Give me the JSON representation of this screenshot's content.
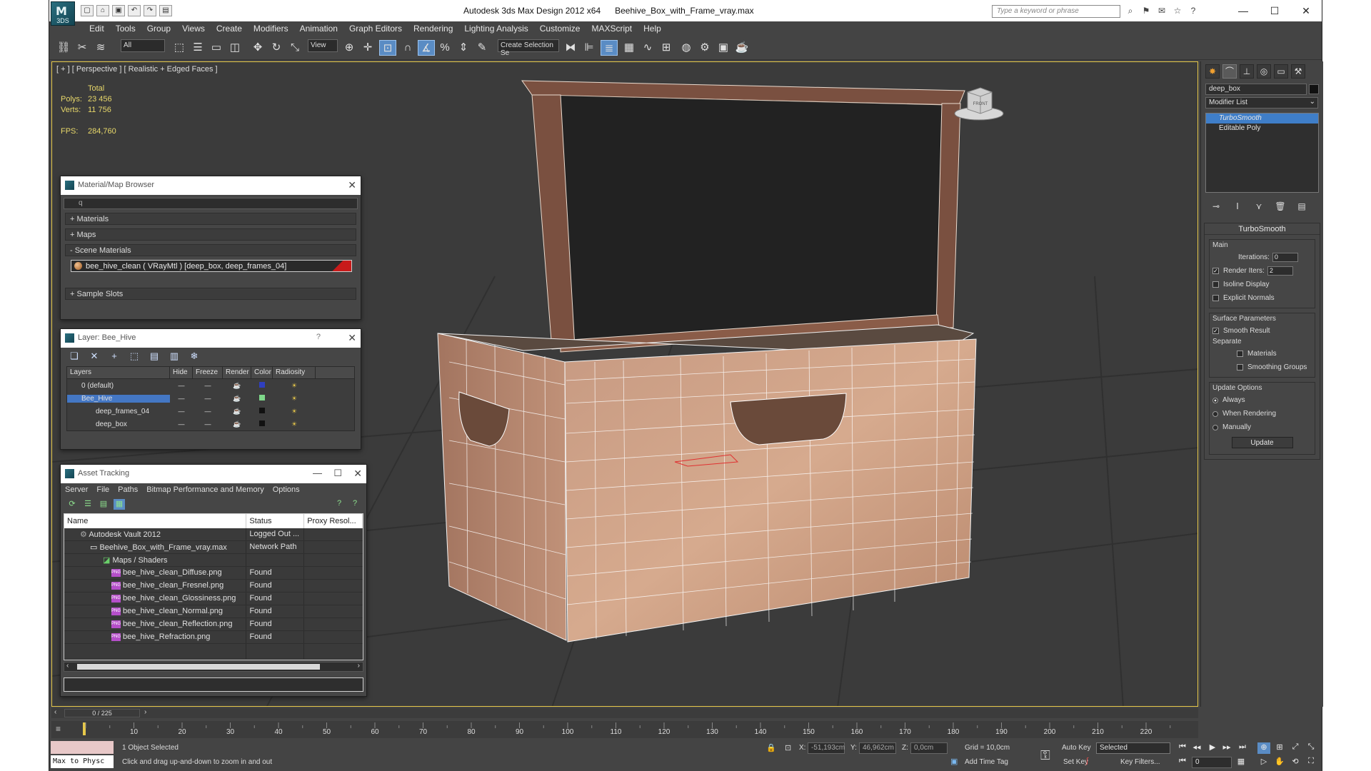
{
  "app": {
    "title": "Autodesk 3ds Max Design 2012 x64      Beehive_Box_with_Frame_vray.max",
    "logo_text": "3DS",
    "help_search_placeholder": "Type a keyword or phrase"
  },
  "menu": [
    "Edit",
    "Tools",
    "Group",
    "Views",
    "Create",
    "Modifiers",
    "Animation",
    "Graph Editors",
    "Rendering",
    "Lighting Analysis",
    "Customize",
    "MAXScript",
    "Help"
  ],
  "toolbar": {
    "selection_filter": "All",
    "ref_coord": "View",
    "named_selection": "Create Selection Se"
  },
  "viewport": {
    "label": "[ + ] [ Perspective ] [ Realistic + Edged Faces ]",
    "stats": {
      "header": "Total",
      "polys_label": "Polys:",
      "polys_value": "23 456",
      "verts_label": "Verts:",
      "verts_value": "11 756",
      "fps_label": "FPS:",
      "fps_value": "284,760"
    },
    "viewcube_label": "FRONT"
  },
  "material_browser": {
    "title": "Material/Map Browser",
    "search_value": "q",
    "sections": [
      "+ Materials",
      "+ Maps",
      "- Scene Materials"
    ],
    "scene_material": "bee_hive_clean  ( VRayMtl )  [deep_box, deep_frames_04]",
    "sample_slots": "+ Sample Slots"
  },
  "layer_panel": {
    "title": "Layer: Bee_Hive",
    "help": "?",
    "columns": [
      "Layers",
      "Hide",
      "Freeze",
      "Render",
      "Color",
      "Radiosity"
    ],
    "rows": [
      {
        "name": "0 (default)",
        "color": "#2f3fbf"
      },
      {
        "name": "Bee_Hive",
        "color": "#7ed88a"
      },
      {
        "name": "deep_frames_04",
        "color": "#111111"
      },
      {
        "name": "deep_box",
        "color": "#111111"
      }
    ]
  },
  "asset_tracking": {
    "title": "Asset Tracking",
    "menu": [
      "Server",
      "File",
      "Paths",
      "Bitmap Performance and Memory",
      "Options"
    ],
    "columns": [
      "Name",
      "Status",
      "Proxy Resol..."
    ],
    "rows": [
      {
        "name": "Autodesk Vault 2012",
        "status": "Logged Out ..."
      },
      {
        "name": "Beehive_Box_with_Frame_vray.max",
        "status": "Network Path"
      },
      {
        "name": "Maps / Shaders",
        "status": ""
      },
      {
        "name": "bee_hive_clean_Diffuse.png",
        "status": "Found"
      },
      {
        "name": "bee_hive_clean_Fresnel.png",
        "status": "Found"
      },
      {
        "name": "bee_hive_clean_Glossiness.png",
        "status": "Found"
      },
      {
        "name": "bee_hive_clean_Normal.png",
        "status": "Found"
      },
      {
        "name": "bee_hive_clean_Reflection.png",
        "status": "Found"
      },
      {
        "name": "bee_hive_Refraction.png",
        "status": "Found"
      }
    ]
  },
  "command_panel": {
    "object_name": "deep_box",
    "modifier_list": "Modifier List",
    "stack": [
      "TurboSmooth",
      "Editable Poly"
    ],
    "rollout_title": "TurboSmooth",
    "main_label": "Main",
    "iterations_label": "Iterations:",
    "iterations_value": "0",
    "render_iters_label": "Render Iters:",
    "render_iters_value": "2",
    "isoline_display": "Isoline Display",
    "explicit_normals": "Explicit Normals",
    "surface_params": "Surface Parameters",
    "smooth_result": "Smooth Result",
    "separate": "Separate",
    "materials": "Materials",
    "smoothing_groups": "Smoothing Groups",
    "update_options": "Update Options",
    "always": "Always",
    "when_rendering": "When Rendering",
    "manually": "Manually",
    "update_button": "Update"
  },
  "timeline": {
    "slider": "0 / 225",
    "ticks": [
      "10",
      "20",
      "30",
      "40",
      "50",
      "60",
      "70",
      "80",
      "90",
      "100",
      "110",
      "120",
      "130",
      "140",
      "150",
      "160",
      "170",
      "180",
      "190",
      "200",
      "210",
      "220"
    ]
  },
  "status": {
    "listener": "Max to Physc",
    "selected": "1 Object Selected",
    "prompt": "Click and drag up-and-down to zoom in and out",
    "x_label": "X:",
    "x_value": "-51,193cm",
    "y_label": "Y:",
    "y_value": "46,962cm",
    "z_label": "Z:",
    "z_value": "0,0cm",
    "grid": "Grid = 10,0cm",
    "add_time_tag": "Add Time Tag",
    "auto_key": "Auto Key",
    "set_key": "Set Key",
    "selected_set": "Selected",
    "key_filters": "Key Filters...",
    "frame": "0"
  }
}
